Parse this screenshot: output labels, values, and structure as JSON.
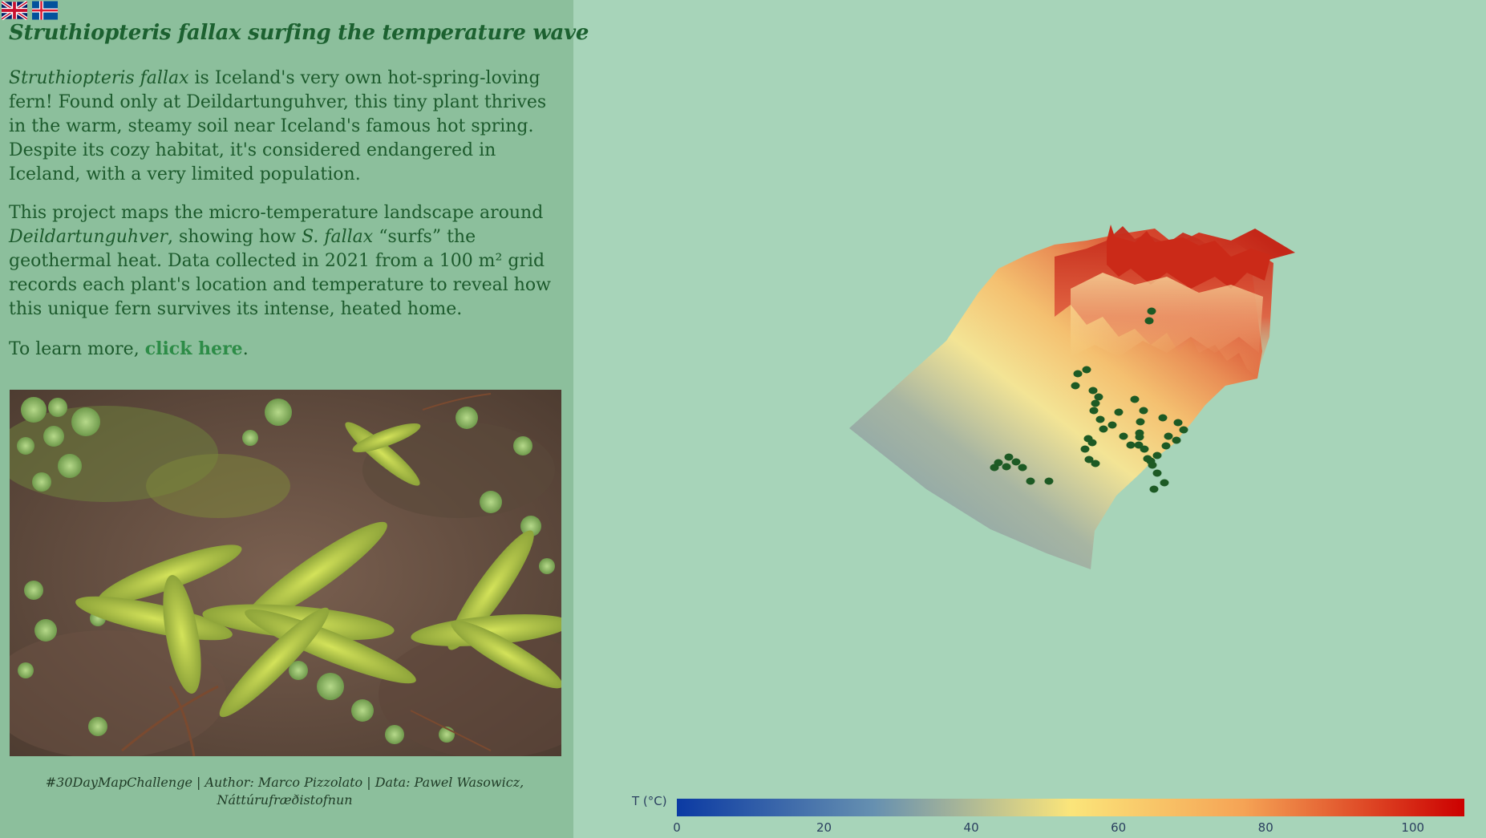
{
  "flags": [
    {
      "name": "uk-flag-icon",
      "language": "English"
    },
    {
      "name": "iceland-flag-icon",
      "language": "Icelandic"
    }
  ],
  "title": "Struthiopteris fallax surfing the temperature wave",
  "paragraph1": {
    "species": "Struthiopteris fallax",
    "text": " is Iceland's very own hot-spring-loving fern! Found only at Deildartunguhver, this tiny plant thrives in the warm, steamy soil near Iceland's famous hot spring. Despite its cozy habitat, it's considered endangered in Iceland, with a very limited population."
  },
  "paragraph2": {
    "intro": "This project maps the micro-temperature landscape around ",
    "place": "Deildartunguhver",
    "middle": ", showing how ",
    "species_short": "S. fallax",
    "rest": " “surfs” the geothermal heat. Data collected in 2021 from a 100 m² grid records each plant's location and temperature to reveal how this unique fern survives its intense, heated home."
  },
  "paragraph3": {
    "prefix": "To learn more, ",
    "link_label": "click here",
    "suffix": "."
  },
  "photo_label": "fern-photo",
  "credit": "#30DayMapChallenge | Author: Marco Pizzolato | Data: Pawel Wasowicz, Náttúrufræðistofnun",
  "colors": {
    "sidebar_bg": "#8cbf9c",
    "plot_bg": "#a7d4b9",
    "title": "#1c6130",
    "link": "#2d8c47",
    "plant_marker": "#1d5a24"
  },
  "chart_data": {
    "type": "surface3d",
    "colorbar": {
      "title": "T (°C)",
      "min": 0,
      "max": 107,
      "ticks": [
        0,
        20,
        40,
        60,
        80,
        100
      ],
      "colorscale": [
        "#0b3aa3",
        "#6690b0",
        "#fbe57a",
        "#f5a355",
        "#cc0000"
      ]
    },
    "grid_area_m2": 100,
    "year": 2021,
    "series": [
      {
        "kind": "surface",
        "variable": "temperature"
      },
      {
        "kind": "markers",
        "variable": "plant locations"
      }
    ]
  }
}
